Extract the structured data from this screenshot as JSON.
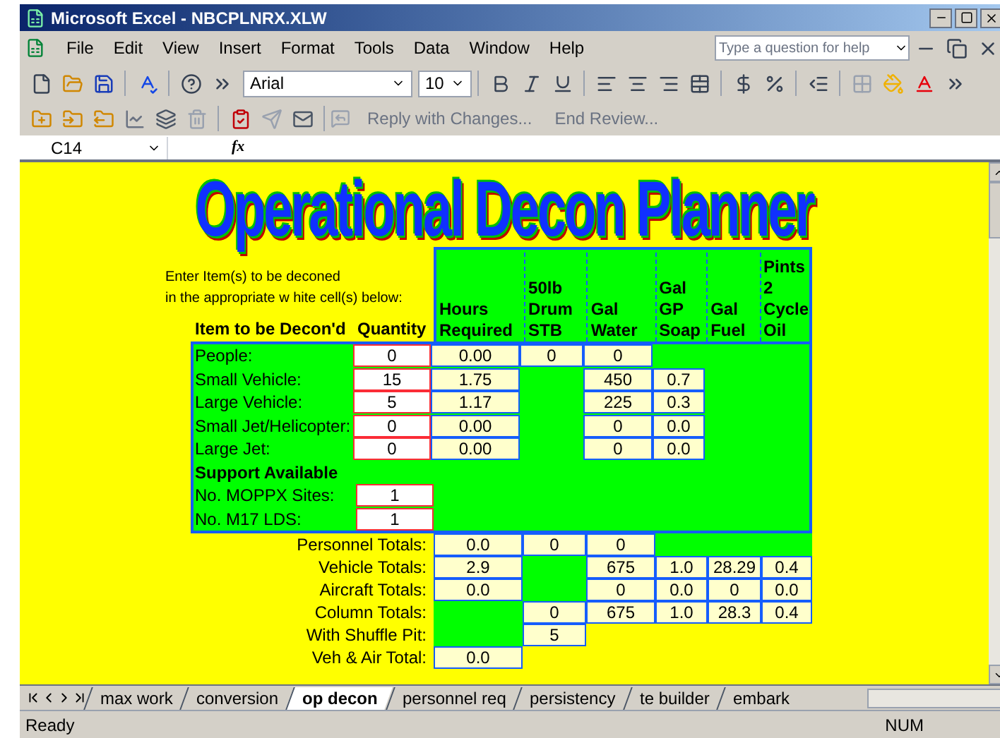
{
  "window": {
    "title": "Microsoft Excel - NBCPLNRX.XLW"
  },
  "menu": [
    "File",
    "Edit",
    "View",
    "Insert",
    "Format",
    "Tools",
    "Data",
    "Window",
    "Help"
  ],
  "help_box": {
    "placeholder": "Type a question for help"
  },
  "formatting": {
    "font": "Arial",
    "size": "10"
  },
  "review_toolbar": [
    {
      "label": "Reply with Changes...",
      "disabled": true
    },
    {
      "label": "End Review...",
      "disabled": true
    }
  ],
  "formula_bar": {
    "name_box": "C14",
    "fx": "fx"
  },
  "sheet": {
    "title": "Operational Decon Planner",
    "instructions": [
      "Enter Item(s) to be deconed",
      "in the appropriate w hite cell(s) below:"
    ],
    "item_heading": "Item to be Decon'd",
    "quantity_heading": "Quantity",
    "columns": [
      "Hours\nRequired",
      "50lb\nDrum\nSTB",
      "Gal\nWater",
      "Gal\nGP\nSoap",
      "Gal\nFuel",
      "Pints\n2\nCycle\nOil"
    ],
    "rows": [
      {
        "kind": "item",
        "label": "People:",
        "quantity": "0",
        "cells": [
          {
            "kind": "value",
            "text": "0.00"
          },
          {
            "kind": "value",
            "text": "0"
          },
          {
            "kind": "value",
            "text": "0"
          },
          {
            "kind": "fill"
          },
          {
            "kind": "fill"
          },
          {
            "kind": "fill"
          }
        ]
      },
      {
        "kind": "item",
        "label": "Small Vehicle:",
        "quantity": "15",
        "cells": [
          {
            "kind": "value",
            "text": "1.75"
          },
          {
            "kind": "fill"
          },
          {
            "kind": "value",
            "text": "450"
          },
          {
            "kind": "value",
            "text": "0.7"
          },
          {
            "kind": "fill"
          },
          {
            "kind": "fill"
          }
        ]
      },
      {
        "kind": "item",
        "label": "Large Vehicle:",
        "quantity": "5",
        "cells": [
          {
            "kind": "value",
            "text": "1.17"
          },
          {
            "kind": "fill"
          },
          {
            "kind": "value",
            "text": "225"
          },
          {
            "kind": "value",
            "text": "0.3"
          },
          {
            "kind": "fill"
          },
          {
            "kind": "fill"
          }
        ]
      },
      {
        "kind": "item",
        "label": "Small Jet/Helicopter:",
        "quantity": "0",
        "cells": [
          {
            "kind": "value",
            "text": "0.00"
          },
          {
            "kind": "fill"
          },
          {
            "kind": "value",
            "text": "0"
          },
          {
            "kind": "value",
            "text": "0.0"
          },
          {
            "kind": "fill"
          },
          {
            "kind": "fill"
          }
        ]
      },
      {
        "kind": "item",
        "label": "Large Jet:",
        "quantity": "0",
        "cells": [
          {
            "kind": "value",
            "text": "0.00"
          },
          {
            "kind": "fill"
          },
          {
            "kind": "value",
            "text": "0"
          },
          {
            "kind": "value",
            "text": "0.0"
          },
          {
            "kind": "fill"
          },
          {
            "kind": "fill"
          }
        ]
      },
      {
        "kind": "section",
        "label": "Support Available"
      },
      {
        "kind": "item",
        "label": "No. MOPPX Sites:",
        "quantity": "1"
      },
      {
        "kind": "item",
        "label": "No. M17 LDS:",
        "quantity": "1"
      }
    ],
    "totals": [
      {
        "label": "Personnel Totals:",
        "cells": [
          {
            "kind": "value",
            "text": "0.0"
          },
          {
            "kind": "value",
            "text": "0"
          },
          {
            "kind": "value",
            "text": "0"
          },
          {
            "kind": "fill"
          },
          {
            "kind": "fill"
          },
          {
            "kind": "fill"
          }
        ]
      },
      {
        "label": "Vehicle Totals:",
        "cells": [
          {
            "kind": "value",
            "text": "2.9"
          },
          {
            "kind": "fill"
          },
          {
            "kind": "value",
            "text": "675"
          },
          {
            "kind": "value",
            "text": "1.0"
          },
          {
            "kind": "value",
            "text": "28.29"
          },
          {
            "kind": "value",
            "text": "0.4"
          }
        ]
      },
      {
        "label": "Aircraft Totals:",
        "cells": [
          {
            "kind": "value",
            "text": "0.0"
          },
          {
            "kind": "fill"
          },
          {
            "kind": "value",
            "text": "0"
          },
          {
            "kind": "value",
            "text": "0.0"
          },
          {
            "kind": "value",
            "text": "0"
          },
          {
            "kind": "value",
            "text": "0.0"
          }
        ]
      },
      {
        "label": "Column Totals:",
        "cells": [
          {
            "kind": "fill"
          },
          {
            "kind": "value",
            "text": "0"
          },
          {
            "kind": "value",
            "text": "675"
          },
          {
            "kind": "value",
            "text": "1.0"
          },
          {
            "kind": "value",
            "text": "28.3"
          },
          {
            "kind": "value",
            "text": "0.4"
          }
        ]
      },
      {
        "label": "With Shuffle Pit:",
        "cells": [
          {
            "kind": "fill"
          },
          {
            "kind": "value",
            "text": "5"
          }
        ]
      },
      {
        "label": "Veh & Air Total:",
        "cells": [
          {
            "kind": "value",
            "text": "0.0"
          }
        ]
      }
    ]
  },
  "sheet_tabs": [
    {
      "label": "max work",
      "selected": false
    },
    {
      "label": "conversion",
      "selected": false
    },
    {
      "label": "op decon",
      "selected": true
    },
    {
      "label": "personnel req",
      "selected": false
    },
    {
      "label": "persistency",
      "selected": false
    },
    {
      "label": "te builder",
      "selected": false
    },
    {
      "label": "embark",
      "selected": false
    }
  ],
  "status_bar": {
    "state": "Ready",
    "num_lock": "NUM"
  }
}
